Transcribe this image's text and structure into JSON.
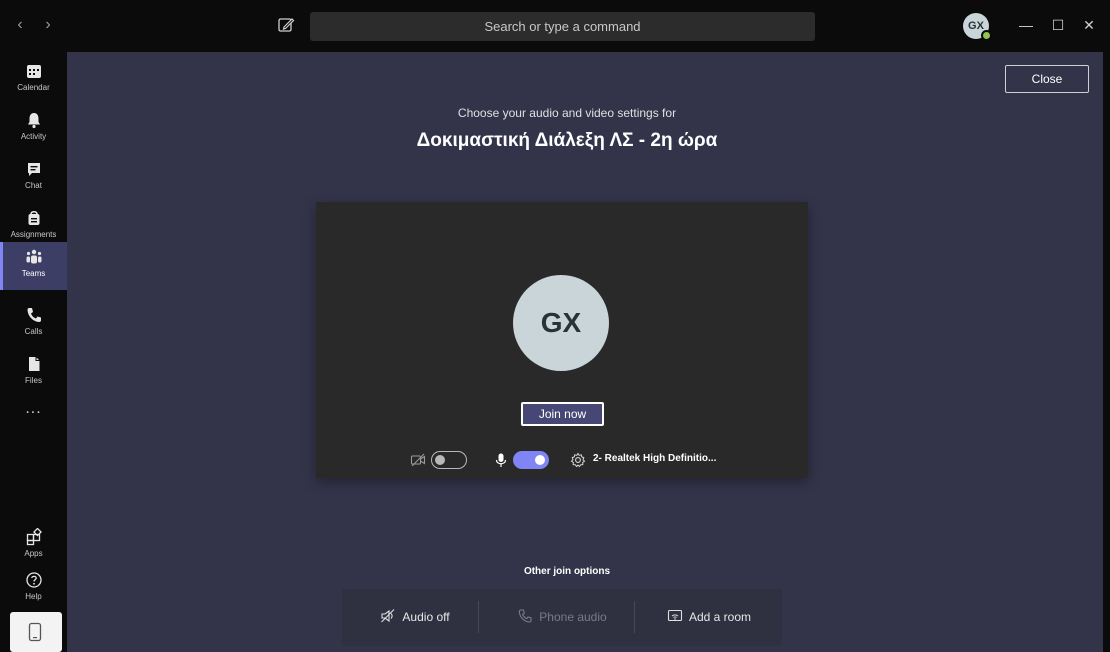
{
  "titlebar": {
    "search_placeholder": "Search or type a command",
    "avatar_initials": "GX"
  },
  "rail": {
    "items": [
      {
        "label": "Calendar",
        "icon": "calendar-icon"
      },
      {
        "label": "Activity",
        "icon": "bell-icon"
      },
      {
        "label": "Chat",
        "icon": "chat-icon"
      },
      {
        "label": "Assignments",
        "icon": "assignments-icon"
      },
      {
        "label": "Teams",
        "icon": "teams-icon",
        "active": true
      },
      {
        "label": "Calls",
        "icon": "phone-icon"
      },
      {
        "label": "Files",
        "icon": "file-icon"
      }
    ],
    "more": "...",
    "apps_label": "Apps",
    "help_label": "Help"
  },
  "main": {
    "close_label": "Close",
    "subtitle": "Choose your audio and video settings for",
    "meeting_title": "Δοκιμαστική Διάλεξη ΛΣ - 2η ώρα",
    "preview": {
      "avatar_initials": "GX",
      "join_label": "Join now",
      "camera_on": false,
      "mic_on": true,
      "device_label": "2- Realtek High Definitio..."
    },
    "other_title": "Other join options",
    "options": [
      {
        "label": "Audio off",
        "icon": "speaker-off-icon"
      },
      {
        "label": "Phone audio",
        "icon": "phone-icon",
        "disabled": true
      },
      {
        "label": "Add a room",
        "icon": "room-cast-icon"
      }
    ]
  },
  "colors": {
    "accent": "#7f85f5",
    "rail_active": "#3d3e66",
    "main_bg": "#33344a",
    "status": "#92c353"
  }
}
